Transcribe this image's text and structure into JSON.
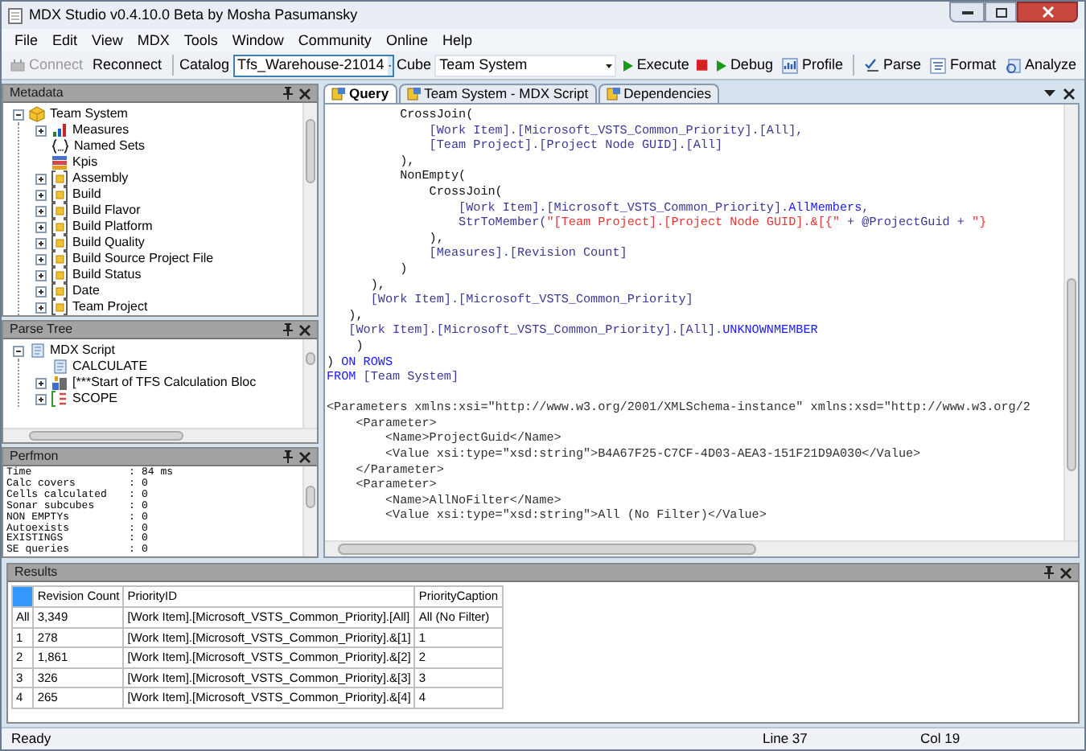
{
  "window": {
    "title": "MDX Studio v0.4.10.0 Beta by Mosha Pasumansky"
  },
  "menu": [
    "File",
    "Edit",
    "View",
    "MDX",
    "Tools",
    "Window",
    "Community",
    "Online",
    "Help"
  ],
  "toolbar": [
    {
      "kind": "connect",
      "label": "Connect",
      "disabled": true
    },
    {
      "kind": "plain",
      "label": "Reconnect",
      "disabled": false
    },
    {
      "kind": "separator"
    },
    {
      "kind": "label",
      "label": "Catalog"
    },
    {
      "kind": "combo",
      "value": "Tfs_Warehouse-21014",
      "focused": true
    },
    {
      "kind": "label",
      "label": "Cube"
    },
    {
      "kind": "combo",
      "value": "Team System",
      "focused": false
    },
    {
      "kind": "run",
      "label": "Execute",
      "disabled": false
    },
    {
      "kind": "stop"
    },
    {
      "kind": "run",
      "label": "Debug",
      "disabled": false
    },
    {
      "kind": "profile",
      "label": "Profile",
      "disabled": false
    },
    {
      "kind": "separator"
    },
    {
      "kind": "parse",
      "label": "Parse",
      "disabled": false
    },
    {
      "kind": "format",
      "label": "Format",
      "disabled": false
    },
    {
      "kind": "analyze",
      "label": "Analyze",
      "disabled": false
    }
  ],
  "metadata": {
    "title": "Metadata",
    "tree": {
      "label": "Team System",
      "kind": "cube",
      "expanded": true,
      "children": [
        {
          "label": "Measures",
          "kind": "measures",
          "expandable": true
        },
        {
          "label": "Named Sets",
          "kind": "sets",
          "expandable": false
        },
        {
          "label": "Kpis",
          "kind": "kpis",
          "expandable": false
        },
        {
          "label": "Assembly",
          "kind": "dimension",
          "expandable": true
        },
        {
          "label": "Build",
          "kind": "dimension",
          "expandable": true
        },
        {
          "label": "Build Flavor",
          "kind": "dimension",
          "expandable": true
        },
        {
          "label": "Build Platform",
          "kind": "dimension",
          "expandable": true
        },
        {
          "label": "Build Quality",
          "kind": "dimension",
          "expandable": true
        },
        {
          "label": "Build Source Project File",
          "kind": "dimension",
          "expandable": true
        },
        {
          "label": "Build Status",
          "kind": "dimension",
          "expandable": true
        },
        {
          "label": "Date",
          "kind": "dimension",
          "expandable": true
        },
        {
          "label": "Team Project",
          "kind": "dimension",
          "expandable": true
        }
      ]
    }
  },
  "parse_tree": {
    "title": "Parse Tree",
    "tree": {
      "label": "MDX Script",
      "kind": "script",
      "expanded": true,
      "children": [
        {
          "label": "CALCULATE",
          "kind": "script",
          "expandable": false
        },
        {
          "label": "[***Start of TFS Calculation Bloc",
          "kind": "block",
          "expandable": true
        },
        {
          "label": "SCOPE",
          "kind": "scope",
          "expandable": true
        }
      ]
    }
  },
  "perfmon": {
    "title": "Perfmon",
    "separator": ":",
    "items": [
      {
        "name": "Time",
        "value": "84 ms"
      },
      {
        "name": "Calc covers",
        "value": "0"
      },
      {
        "name": "Cells calculated",
        "value": "0"
      },
      {
        "name": "Sonar subcubes",
        "value": "0"
      },
      {
        "name": "NON EMPTYs",
        "value": "0"
      },
      {
        "name": "Autoexists",
        "value": "0"
      },
      {
        "name": "EXISTINGS",
        "value": "0"
      },
      {
        "name": "SE queries",
        "value": "0"
      }
    ]
  },
  "editor": {
    "tabs": [
      {
        "label": "Query",
        "selected": true
      },
      {
        "label": "Team System - MDX Script",
        "selected": false
      },
      {
        "label": "Dependencies",
        "selected": false
      }
    ],
    "lines": [
      [
        {
          "text": "          CrossJoin(",
          "kind": "plain"
        }
      ],
      [
        {
          "text": "              [Work Item].[Microsoft_VSTS_Common_Priority].[All],",
          "kind": "member"
        }
      ],
      [
        {
          "text": "              [Team Project].[Project Node GUID].[All]",
          "kind": "member"
        }
      ],
      [
        {
          "text": "          ),",
          "kind": "plain"
        }
      ],
      [
        {
          "text": "          NonEmpty(",
          "kind": "plain"
        }
      ],
      [
        {
          "text": "              CrossJoin(",
          "kind": "plain"
        }
      ],
      [
        {
          "text": "                  [Work Item].[Microsoft_VSTS_Common_Priority].",
          "kind": "member"
        },
        {
          "text": "AllMembers",
          "kind": "keyword"
        },
        {
          "text": ",",
          "kind": "member"
        }
      ],
      [
        {
          "text": "                  StrToMember(",
          "kind": "member"
        },
        {
          "text": "\"[Team Project].[Project Node GUID].&[{\"",
          "kind": "string"
        },
        {
          "text": " + @ProjectGuid + ",
          "kind": "member"
        },
        {
          "text": "\"}",
          "kind": "string"
        }
      ],
      [
        {
          "text": "              ),",
          "kind": "plain"
        }
      ],
      [
        {
          "text": "              [Measures].[Revision Count]",
          "kind": "member"
        }
      ],
      [
        {
          "text": "          )",
          "kind": "plain"
        }
      ],
      [
        {
          "text": "      ),",
          "kind": "plain"
        }
      ],
      [
        {
          "text": "      [Work Item].[Microsoft_VSTS_Common_Priority]",
          "kind": "member"
        }
      ],
      [
        {
          "text": "   ),",
          "kind": "plain"
        }
      ],
      [
        {
          "text": "   [Work Item].[Microsoft_VSTS_Common_Priority].[All].",
          "kind": "member"
        },
        {
          "text": "UNKNOWNMEMBER",
          "kind": "keyword"
        }
      ],
      [
        {
          "text": "    )",
          "kind": "plain"
        }
      ],
      [
        {
          "text": ") ",
          "kind": "plain"
        },
        {
          "text": "ON ROWS",
          "kind": "keyword"
        }
      ],
      [
        {
          "text": "FROM ",
          "kind": "keyword"
        },
        {
          "text": "[Team System]",
          "kind": "member"
        }
      ]
    ],
    "parameter_lines": [
      [
        {
          "text": "<Parameters xmlns:xsi=\"http://www.w3.org/2001/XMLSchema-instance\" xmlns:xsd=\"http://www.w3.org/2",
          "kind": "xml"
        }
      ],
      [
        {
          "text": "    <Parameter>",
          "kind": "xml"
        }
      ],
      [
        {
          "text": "        <Name>ProjectGuid</Name>",
          "kind": "xml"
        }
      ],
      [
        {
          "text": "        <Value xsi:type=\"xsd:string\">B4A67F25-C7CF-4D03-AEA3-151F21D9A030</Value>",
          "kind": "xml"
        }
      ],
      [
        {
          "text": "    </Parameter>",
          "kind": "xml"
        }
      ],
      [
        {
          "text": "    <Parameter>",
          "kind": "xml"
        }
      ],
      [
        {
          "text": "        <Name>AllNoFilter</Name>",
          "kind": "xml"
        }
      ],
      [
        {
          "text": "        <Value xsi:type=\"xsd:string\">All (No Filter)</Value>",
          "kind": "xml"
        }
      ]
    ]
  },
  "results": {
    "title": "Results",
    "columns": [
      "Revision Count",
      "PriorityID",
      "PriorityCaption"
    ],
    "rows": [
      {
        "header": "All",
        "cells": [
          "3,349",
          "[Work Item].[Microsoft_VSTS_Common_Priority].[All]",
          "All (No Filter)"
        ]
      },
      {
        "header": "1",
        "cells": [
          "278",
          "[Work Item].[Microsoft_VSTS_Common_Priority].&[1]",
          "1"
        ]
      },
      {
        "header": "2",
        "cells": [
          "1,861",
          "[Work Item].[Microsoft_VSTS_Common_Priority].&[2]",
          "2"
        ]
      },
      {
        "header": "3",
        "cells": [
          "326",
          "[Work Item].[Microsoft_VSTS_Common_Priority].&[3]",
          "3"
        ]
      },
      {
        "header": "4",
        "cells": [
          "265",
          "[Work Item].[Microsoft_VSTS_Common_Priority].&[4]",
          "4"
        ]
      }
    ]
  },
  "status_bar": {
    "message": "Ready",
    "line": "Line 37",
    "column": "Col 19"
  }
}
